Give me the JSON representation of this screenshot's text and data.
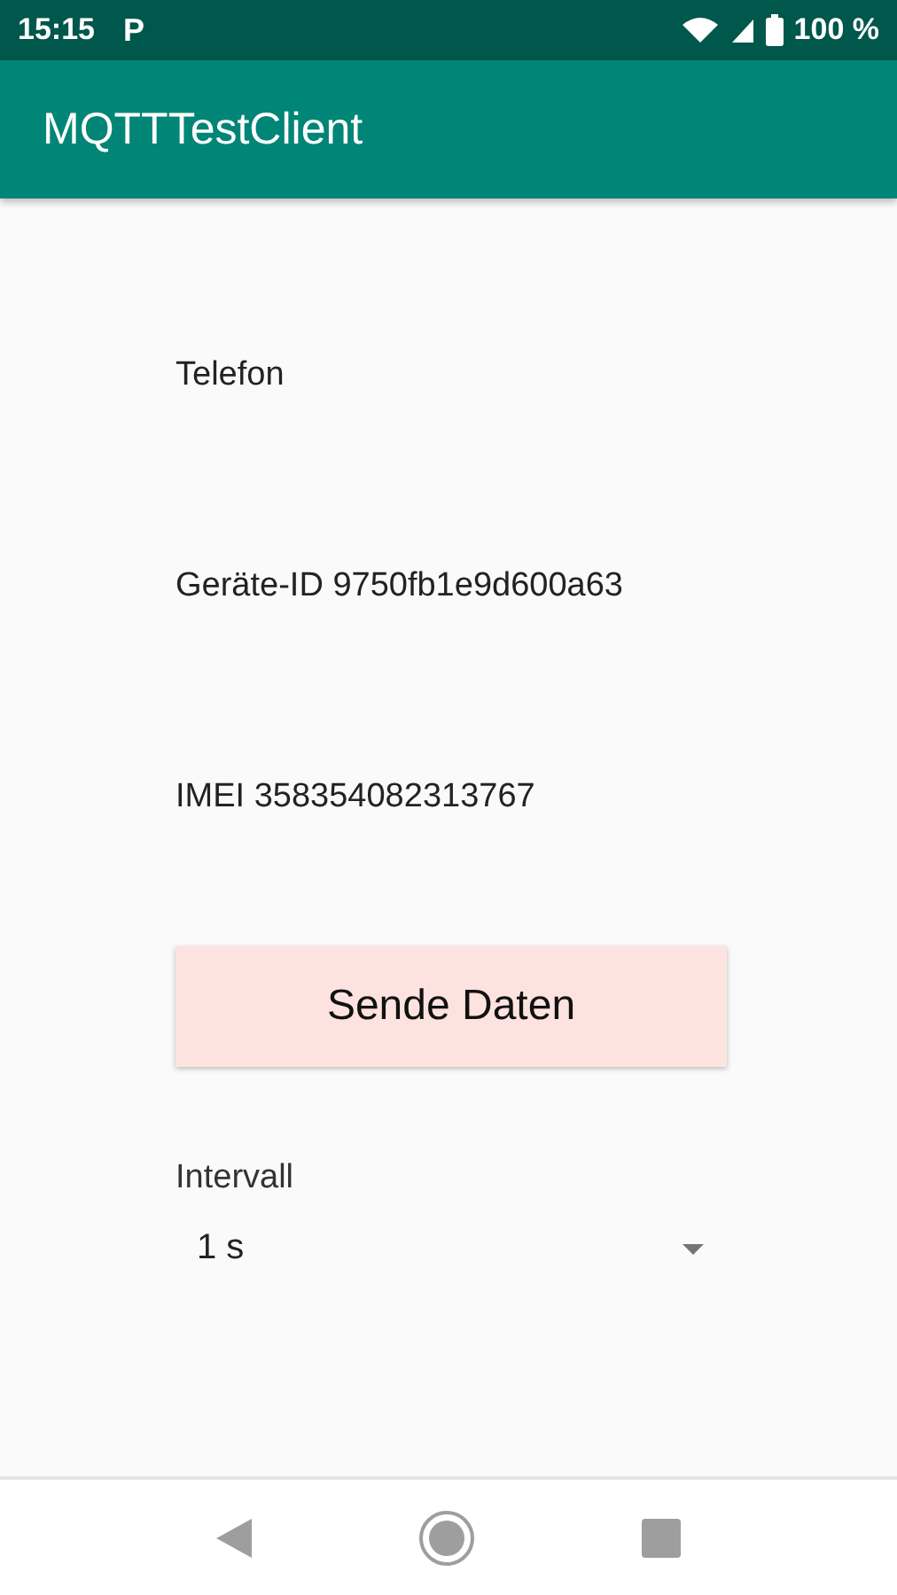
{
  "status_bar": {
    "time": "15:15",
    "notification": "P",
    "battery": "100 %"
  },
  "app_bar": {
    "title": "MQTTTestClient"
  },
  "info_lines": [
    "Telefon",
    "Geräte-ID 9750fb1e9d600a63",
    "IMEI 358354082313767"
  ],
  "send_button": {
    "label": "Sende Daten"
  },
  "interval": {
    "label": "Intervall",
    "value": "1 s"
  }
}
